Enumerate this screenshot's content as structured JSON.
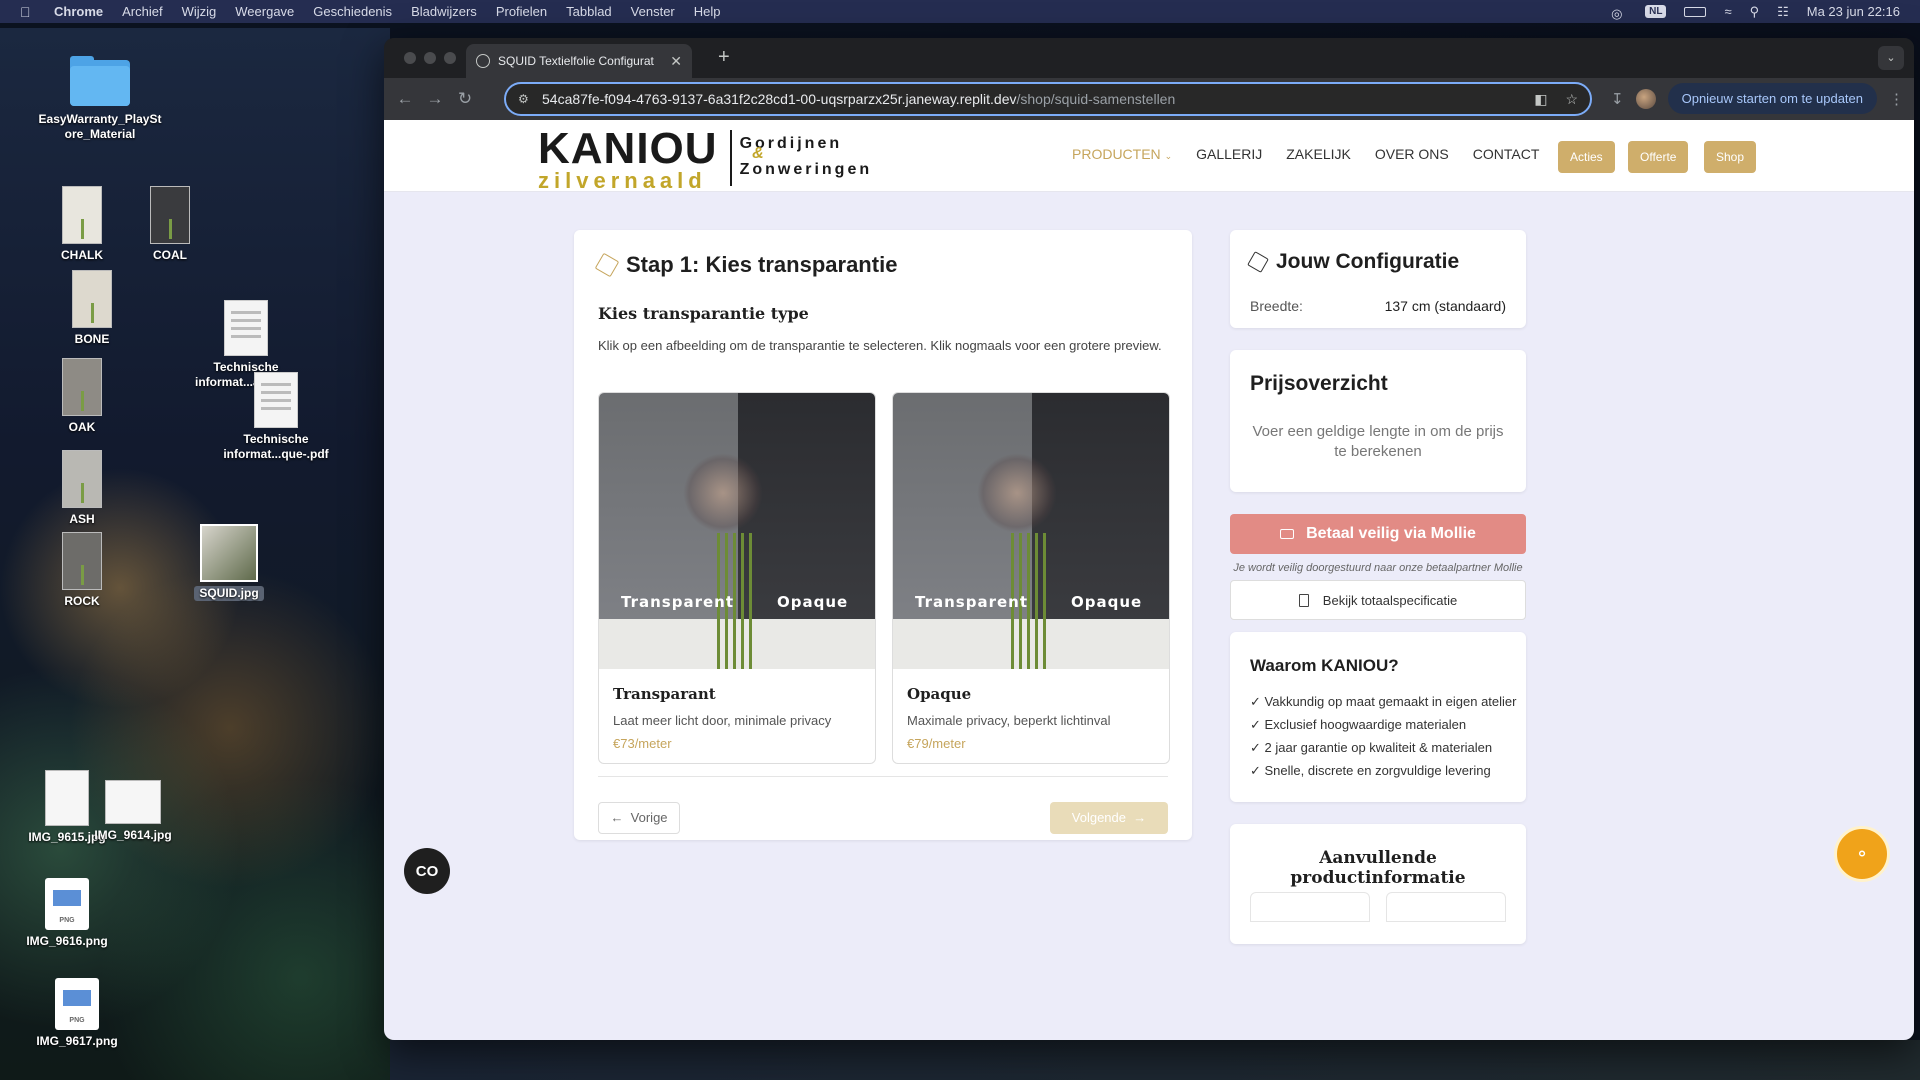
{
  "menubar": {
    "app": "Chrome",
    "items": [
      "Archief",
      "Wijzig",
      "Weergave",
      "Geschiedenis",
      "Bladwijzers",
      "Profielen",
      "Tabblad",
      "Venster",
      "Help"
    ],
    "lang": "NL",
    "datetime": "Ma 23 jun  22:16"
  },
  "desktop": {
    "folder": "EasyWarranty_PlayStore_Material",
    "fabrics": [
      "CHALK",
      "COAL",
      "BONE",
      "OAK",
      "ASH",
      "ROCK"
    ],
    "pdf1": "Technische informat...ant-.pdf",
    "pdf2": "Technische informat...que-.pdf",
    "squid": "SQUID.jpg",
    "img9615": "IMG_9615.jpg",
    "img9614": "IMG_9614.jpg",
    "img9616": "IMG_9616.png",
    "img9617": "IMG_9617.png",
    "png_tag": "PNG"
  },
  "browser": {
    "tab_title": "SQUID Textielfolie Configurat",
    "url_host": "54ca87fe-f094-4763-9137-6a31f2c28cd1-00-uqsrparzx25r.janeway.replit.dev",
    "url_path": "/shop/squid-samenstellen",
    "update_label": "Opnieuw starten om te updaten"
  },
  "header": {
    "logo_main": "KANIOU",
    "logo_sub": "zilvernaald",
    "logo_right1": "Gordijnen",
    "logo_amp": "&",
    "logo_right2": "Zonweringen",
    "nav": [
      "PRODUCTEN",
      "GALLERIJ",
      "ZAKELIJK",
      "OVER ONS",
      "CONTACT"
    ],
    "btn_acties": "Acties",
    "btn_offerte": "Offerte",
    "btn_shop": "Shop"
  },
  "step": {
    "title": "Stap 1: Kies transparantie",
    "heading": "Kies transparantie type",
    "description": "Klik op een afbeelding om de transparantie te selecteren. Klik nogmaals voor een grotere preview.",
    "options": [
      {
        "img_left": "Transparent",
        "img_right": "Opaque",
        "name": "Transparant",
        "desc": "Laat meer licht door, minimale privacy",
        "price": "€73/meter"
      },
      {
        "img_left": "Transparent",
        "img_right": "Opaque",
        "name": "Opaque",
        "desc": "Maximale privacy, beperkt lichtinval",
        "price": "€79/meter"
      }
    ],
    "prev": "Vorige",
    "next": "Volgende"
  },
  "config": {
    "title": "Jouw Configuratie",
    "width_label": "Breedte:",
    "width_value": "137 cm (standaard)"
  },
  "pricing": {
    "title": "Prijsoverzicht",
    "message": "Voer een geldige lengte in om de prijs te berekenen"
  },
  "payment": {
    "button": "Betaal veilig via Mollie",
    "note": "Je wordt veilig doorgestuurd naar onze betaalpartner Mollie",
    "spec_button": "Bekijk totaalspecificatie"
  },
  "why": {
    "title": "Waarom KANIOU?",
    "items": [
      "✓ Vakkundig op maat gemaakt in eigen atelier",
      "✓ Exclusief hoogwaardige materialen",
      "✓ 2 jaar garantie op kwaliteit & materialen",
      "✓ Snelle, discrete en zorgvuldige levering"
    ]
  },
  "info": {
    "title": "Aanvullende productinformatie"
  },
  "colors": {
    "accent": "#c6a55c",
    "pay": "#e28b85",
    "chat": "#f0a31a"
  }
}
